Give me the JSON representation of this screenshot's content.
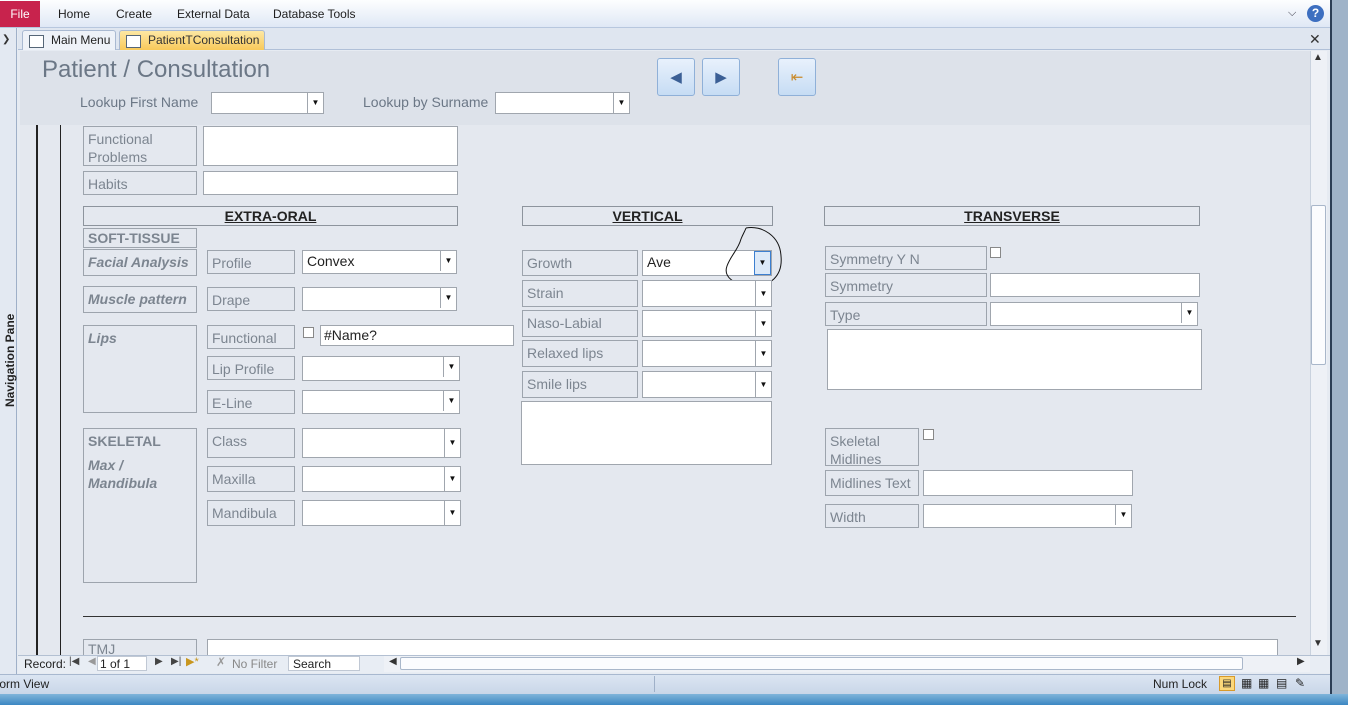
{
  "ribbon": {
    "file": "File",
    "tabs": [
      "Home",
      "Create",
      "External Data",
      "Database Tools"
    ]
  },
  "nav_pane": {
    "label": "Navigation Pane"
  },
  "doc_tabs": {
    "main": "Main Menu",
    "patient": "PatientTConsultation"
  },
  "header": {
    "title": "Patient / Consultation",
    "lookup_first_label": "Lookup First Name",
    "lookup_first_value": "",
    "lookup_surname_label": "Lookup by Surname",
    "lookup_surname_value": ""
  },
  "top_fields": {
    "functional_problems": "Functional Problems",
    "habits": "Habits"
  },
  "extra_oral": {
    "header": "EXTRA-ORAL",
    "soft_tissue": "SOFT-TISSUE",
    "facial_analysis": "Facial Analysis",
    "profile_label": "Profile",
    "profile_value": "Convex",
    "muscle_pattern": "Muscle pattern",
    "drape_label": "Drape",
    "lips": "Lips",
    "functional_label": "Functional",
    "functional_value": "#Name?",
    "lip_profile_label": "Lip Profile",
    "eline_label": "E-Line",
    "skeletal": "SKELETAL",
    "max_mandibula": "Max / Mandibula",
    "class_label": "Class",
    "maxilla_label": "Maxilla",
    "mandibula_label": "Mandibula"
  },
  "vertical": {
    "header": "VERTICAL",
    "growth_label": "Growth",
    "growth_value": "Ave",
    "strain_label": "Strain",
    "naso_labial_label": "Naso-Labial",
    "relaxed_lips_label": "Relaxed lips",
    "smile_lips_label": "Smile lips"
  },
  "transverse": {
    "header": "TRANSVERSE",
    "symmetry_yn_label": "Symmetry Y N",
    "symmetry_label": "Symmetry",
    "type_label": "Type",
    "skeletal_midlines_label": "Skeletal Midlines",
    "midlines_text_label": "Midlines Text",
    "width_label": "Width"
  },
  "bottom": {
    "tmj_label": "TMJ"
  },
  "record_nav": {
    "record_label": "Record:",
    "position": "1 of 1",
    "filter": "No Filter",
    "search": "Search"
  },
  "status": {
    "view": "Form View",
    "num_lock": "Num Lock"
  }
}
